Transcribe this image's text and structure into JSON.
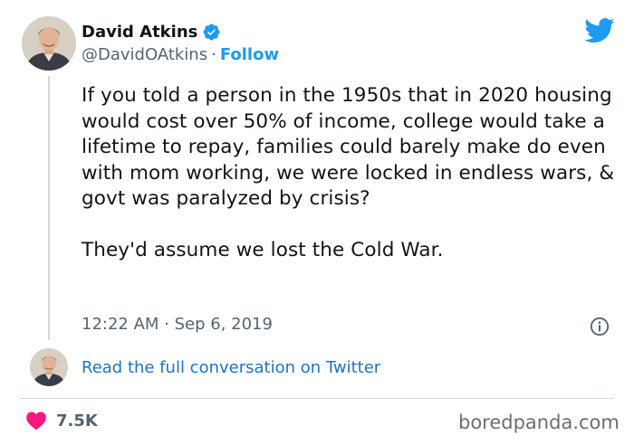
{
  "author": {
    "name": "David Atkins",
    "handle": "@DavidOAtkins",
    "separator": "·",
    "follow_label": "Follow",
    "verified": true
  },
  "tweet": {
    "paragraphs": [
      "If you told a person in the 1950s that in 2020 housing would cost over 50% of income, college would take a lifetime to repay, families could barely make do even with mom working, we were locked in endless wars, & govt was paralyzed by crisis?",
      "They'd assume we lost the Cold War."
    ],
    "timestamp": "12:22 AM · Sep 6, 2019"
  },
  "conversation": {
    "link_label": "Read the full conversation on Twitter"
  },
  "engagement": {
    "likes": "7.5K"
  },
  "watermark": "boredpanda.com",
  "icons": {
    "platform": "twitter-bird-icon",
    "verified": "verified-badge-icon",
    "info": "info-icon",
    "like": "heart-icon"
  },
  "colors": {
    "accent": "#1d9bf0",
    "link": "#1d73c9",
    "heart": "#f91880",
    "text": "#0f1419",
    "muted": "#536471"
  }
}
